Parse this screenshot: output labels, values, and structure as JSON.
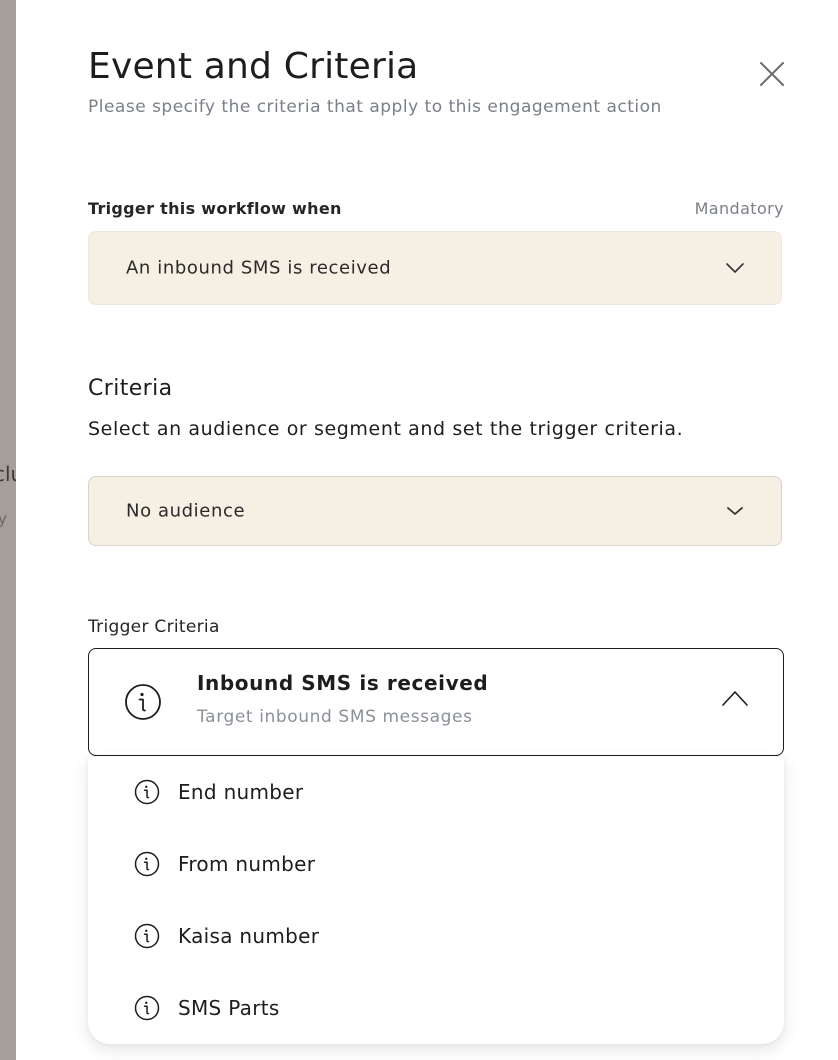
{
  "backdrop": {
    "peek_line_1": "clu",
    "peek_line_2": "y"
  },
  "modal": {
    "title": "Event and Criteria",
    "subtitle": "Please specify the criteria that apply to this engagement action",
    "close_icon": "close-icon"
  },
  "trigger": {
    "label": "Trigger this workflow when",
    "mandatory": "Mandatory",
    "selected": "An inbound SMS is received"
  },
  "criteria": {
    "title": "Criteria",
    "description": "Select an audience or segment and set the trigger criteria.",
    "audience_selected": "No audience"
  },
  "trigger_criteria": {
    "label": "Trigger Criteria",
    "selected_title": "Inbound SMS is received",
    "selected_subtitle": "Target inbound SMS messages",
    "options": [
      {
        "label": "End number",
        "icon": "info-icon"
      },
      {
        "label": "From number",
        "icon": "info-icon"
      },
      {
        "label": "Kaisa number",
        "icon": "info-icon"
      },
      {
        "label": "SMS Parts",
        "icon": "info-icon"
      }
    ]
  },
  "colors": {
    "select_bg": "#f6efe3",
    "text": "#1d1d1d",
    "muted": "#7a7f88",
    "backdrop": "#a49f99"
  }
}
